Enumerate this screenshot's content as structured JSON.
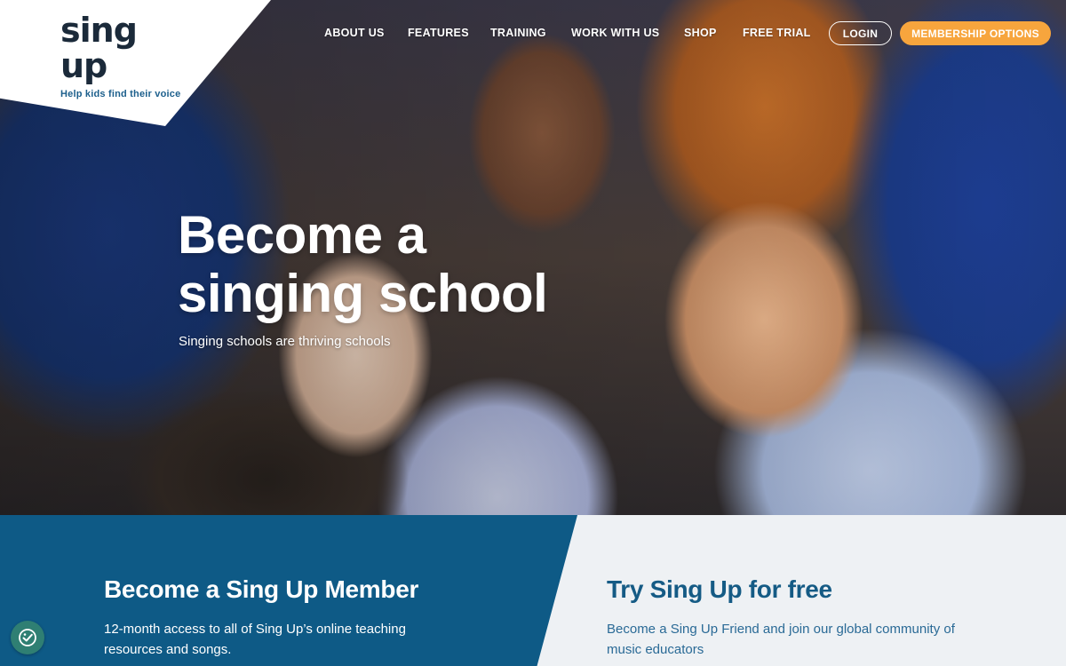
{
  "brand": {
    "logo_text": "sing up",
    "tagline": "Help kids find their voice"
  },
  "nav": {
    "items": [
      "ABOUT US",
      "FEATURES",
      "TRAINING",
      "WORK WITH US",
      "SHOP",
      "FREE TRIAL"
    ],
    "login_label": "LOGIN",
    "membership_label": "MEMBERSHIP OPTIONS"
  },
  "hero": {
    "title_line1": "Become a",
    "title_line2": "singing school",
    "subtitle": "Singing schools are thriving schools"
  },
  "member_panel": {
    "title": "Become a Sing Up Member",
    "text": "12-month access to all of Sing Up’s online teaching resources and songs."
  },
  "trial_panel": {
    "title": "Try Sing Up for free",
    "text": "Become a Sing Up Friend and join our global community of music educators"
  },
  "colors": {
    "primary_blue": "#0e5a86",
    "accent_orange": "#f7a53d",
    "light_panel": "#eef1f4"
  },
  "icons": {
    "accessibility": "accessibility-icon"
  }
}
